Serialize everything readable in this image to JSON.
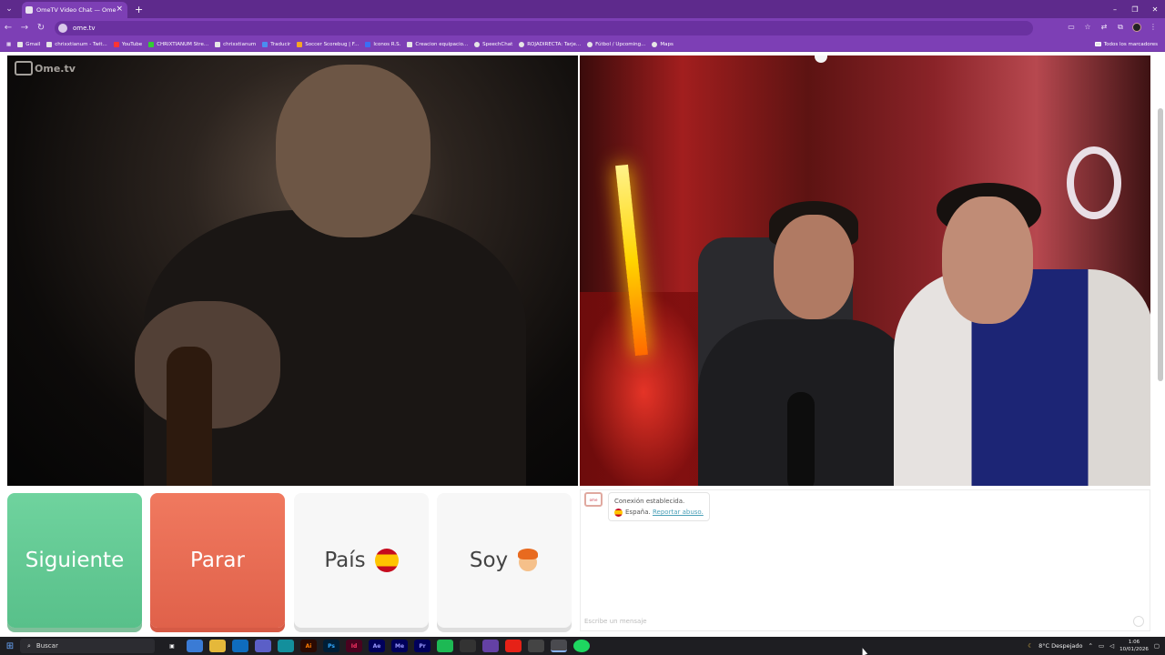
{
  "browser": {
    "tab_title": "OmeTV Video Chat — Ome",
    "url": "ome.tv",
    "new_tab_label": "+",
    "bookmarks": [
      "Gmail",
      "chrixxtianum - Twit...",
      "YouTube",
      "CHRIXTIANUM Stre...",
      "chrixxtianum",
      "Traducir",
      "Soccer Scorebug | F...",
      "Iconos R.S.",
      "Creacion equipacio...",
      "SpeechChat",
      "ROJADIRECTA: Tarje...",
      "Fútbol / Upcoming...",
      "Maps"
    ],
    "all_bookmarks": "Todos los marcadores"
  },
  "page": {
    "logo": "Ome.tv",
    "buttons": {
      "next": "Siguiente",
      "stop": "Parar",
      "country": "País",
      "gender": "Soy"
    },
    "chat": {
      "status": "Conexión establecida.",
      "country": "España.",
      "report": "Reportar abuso.",
      "placeholder": "Escribe un mensaje"
    }
  },
  "taskbar": {
    "search_placeholder": "Buscar",
    "weather": "8°C  Despejado",
    "time": "1:06",
    "date": "10/01/2026"
  },
  "colors": {
    "browser_purple": "#7d3fb5",
    "next_green": "#62c993",
    "stop_red": "#e86c54"
  }
}
